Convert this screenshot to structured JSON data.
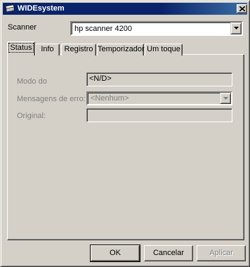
{
  "window": {
    "title": "WIDEsystem"
  },
  "scanner": {
    "label": "Scanner",
    "selected": "hp scanner 4200"
  },
  "tabs": [
    {
      "label": "Status",
      "active": true
    },
    {
      "label": "Info",
      "active": false
    },
    {
      "label": "Registro",
      "active": false
    },
    {
      "label": "Temporizador",
      "active": false
    },
    {
      "label": "Um toque",
      "active": false
    }
  ],
  "status": {
    "mode_label": "Modo do",
    "mode_value": "<N/D>",
    "errors_label": "Mensagens de erro:",
    "errors_value": "<Nenhum>",
    "original_label": "Original:",
    "original_value": ""
  },
  "buttons": {
    "ok": "OK",
    "cancel": "Cancelar",
    "apply": "Aplicar"
  }
}
